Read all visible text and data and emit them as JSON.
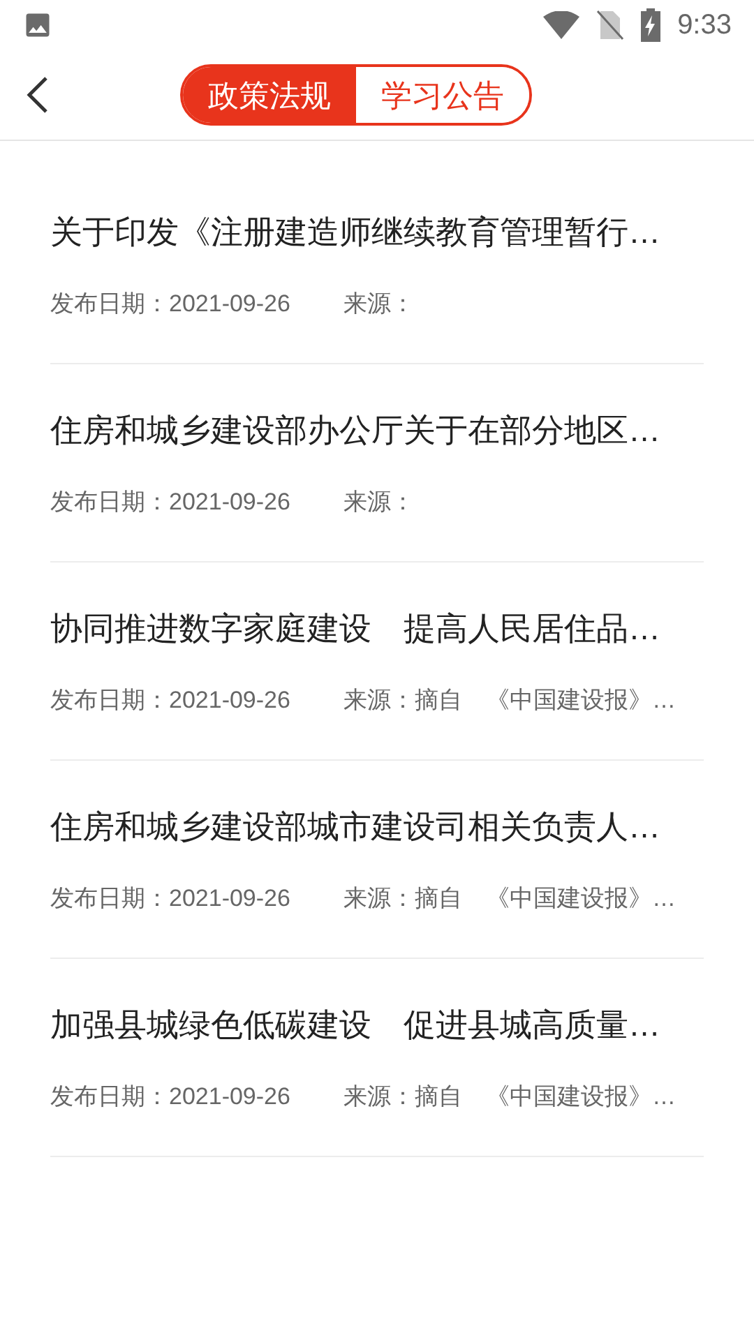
{
  "status_bar": {
    "time": "9:33"
  },
  "tabs": [
    {
      "label": "政策法规",
      "selected": true
    },
    {
      "label": "学习公告",
      "selected": false
    }
  ],
  "articles": [
    {
      "title": "关于印发《注册建造师继续教育管理暂行…",
      "date": "发布日期：2021-09-26",
      "source": "来源："
    },
    {
      "title": "住房和城乡建设部办公厅关于在部分地区…",
      "date": "发布日期：2021-09-26",
      "source": "来源："
    },
    {
      "title": "协同推进数字家庭建设　提高人民居住品…",
      "date": "发布日期：2021-09-26",
      "source": "来源：摘自　《中国建设报》…"
    },
    {
      "title": "住房和城乡建设部城市建设司相关负责人…",
      "date": "发布日期：2021-09-26",
      "source": "来源：摘自　《中国建设报》…"
    },
    {
      "title": "加强县城绿色低碳建设　促进县城高质量…",
      "date": "发布日期：2021-09-26",
      "source": "来源：摘自　《中国建设报》…"
    }
  ]
}
